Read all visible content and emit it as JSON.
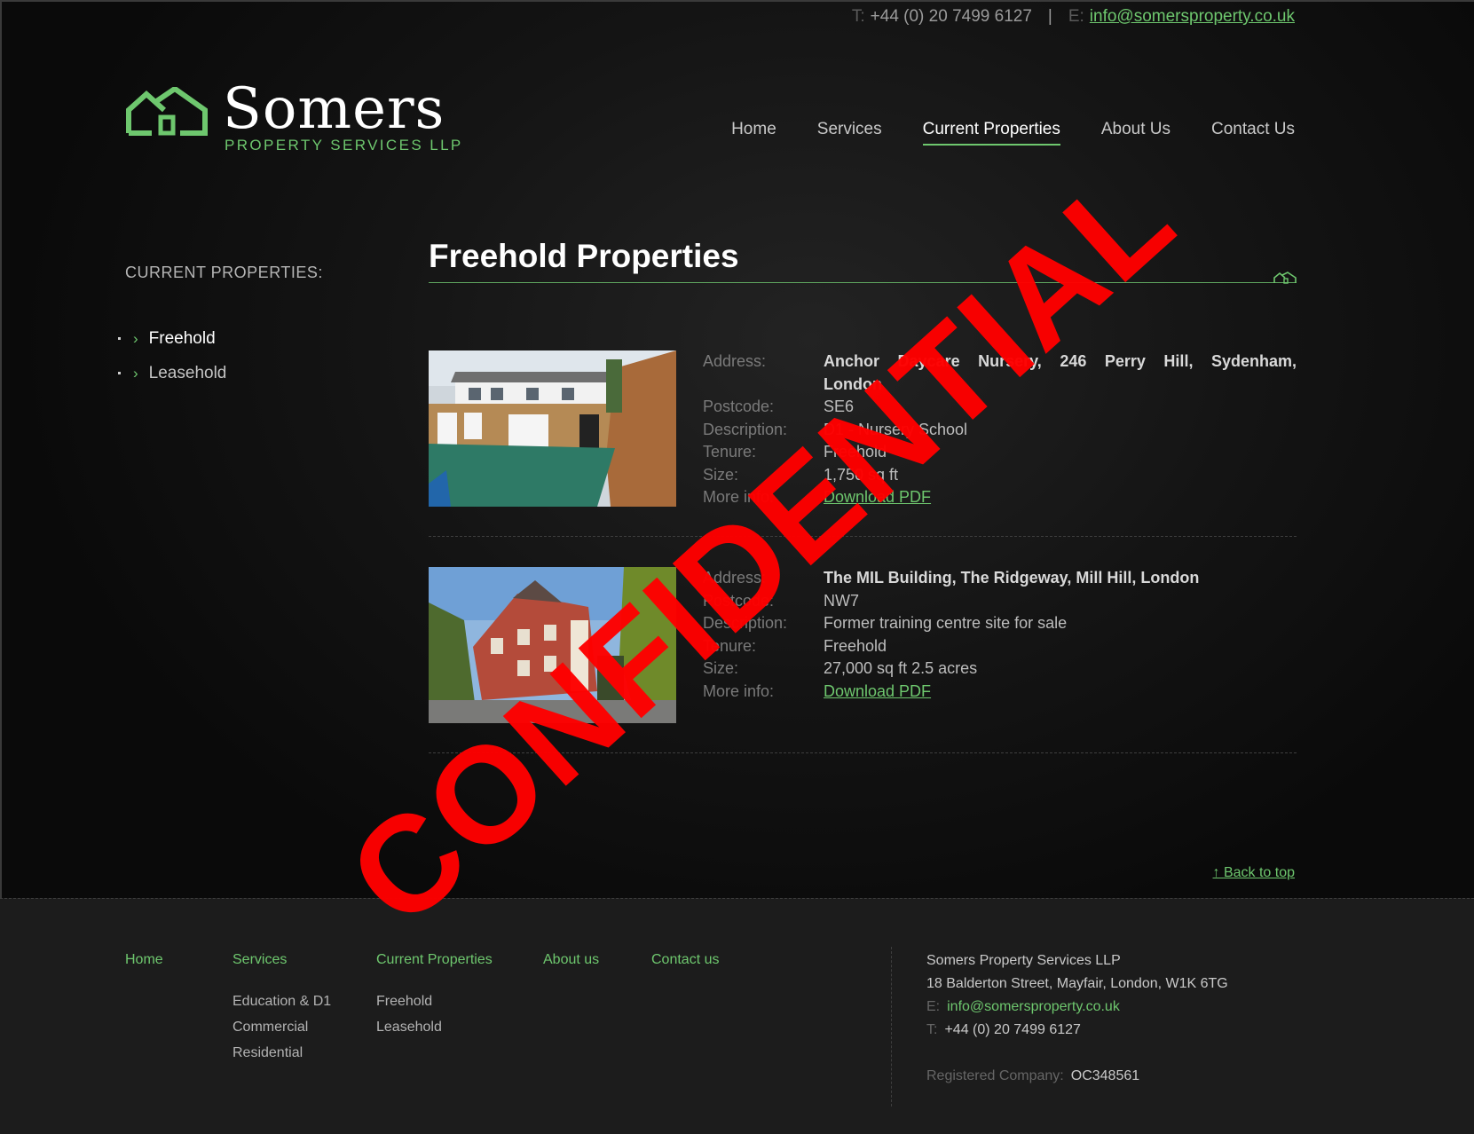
{
  "header": {
    "phone_label": "T:",
    "phone": "+44 (0) 20 7499 6127",
    "separator": "|",
    "email_label": "E:",
    "email": "info@somersproperty.co.uk"
  },
  "logo": {
    "name": "Somers",
    "tagline": "PROPERTY SERVICES LLP",
    "icon": "houses-logo-icon"
  },
  "nav": {
    "items": [
      "Home",
      "Services",
      "Current Properties",
      "About Us",
      "Contact Us"
    ],
    "active": "Current Properties"
  },
  "sidebar": {
    "title": "CURRENT PROPERTIES:",
    "items": [
      {
        "label": "Freehold",
        "active": true
      },
      {
        "label": "Leasehold",
        "active": false
      }
    ]
  },
  "main": {
    "title": "Freehold Properties",
    "properties": [
      {
        "image": "property-photo-nursery",
        "fields": [
          {
            "label": "Address:",
            "value": "Anchor Daycare Nursery, 246 Perry Hill, Sydenham,"
          },
          {
            "label": "",
            "value": "London"
          },
          {
            "label": "Postcode:",
            "value": "SE6"
          },
          {
            "label": "Description:",
            "value": "D1 - Nursery School"
          },
          {
            "label": "Tenure:",
            "value": "Freehold"
          },
          {
            "label": "Size:",
            "value": "1,750 sq ft"
          },
          {
            "label": "More info:",
            "value": "Download PDF"
          }
        ]
      },
      {
        "image": "property-photo-mill-building",
        "fields": [
          {
            "label": "Address:",
            "value": "The MIL Building, The Ridgeway, Mill Hill, London"
          },
          {
            "label": "Postcode:",
            "value": "NW7"
          },
          {
            "label": "Description:",
            "value": "Former training centre site for sale"
          },
          {
            "label": "Tenure:",
            "value": "Freehold"
          },
          {
            "label": "Size:",
            "value": "27,000 sq ft 2.5 acres"
          },
          {
            "label": "More info:",
            "value": "Download PDF"
          }
        ]
      }
    ],
    "back_to_top": "Back to top"
  },
  "footer": {
    "columns": [
      {
        "head": "Home",
        "items": []
      },
      {
        "head": "Services",
        "items": [
          "Education & D1",
          "Commercial",
          "Residential"
        ]
      },
      {
        "head": "Current Properties",
        "items": [
          "Freehold",
          "Leasehold"
        ]
      },
      {
        "head": "About us",
        "items": []
      },
      {
        "head": "Contact us",
        "items": []
      }
    ],
    "company": "Somers Property Services LLP",
    "address": "18 Balderton Street, Mayfair, London, W1K 6TG",
    "email_label": "E:",
    "email": "info@somersproperty.co.uk",
    "phone_label": "T:",
    "phone": "+44 (0) 20 7499 6127",
    "reg_label": "Registered Company:",
    "reg_number": "OC348561"
  },
  "overlay": {
    "stamp": "CONFIDENTIAL"
  },
  "colors": {
    "accent": "#6ec76e",
    "stamp": "#ff0000",
    "background": "#141414"
  }
}
